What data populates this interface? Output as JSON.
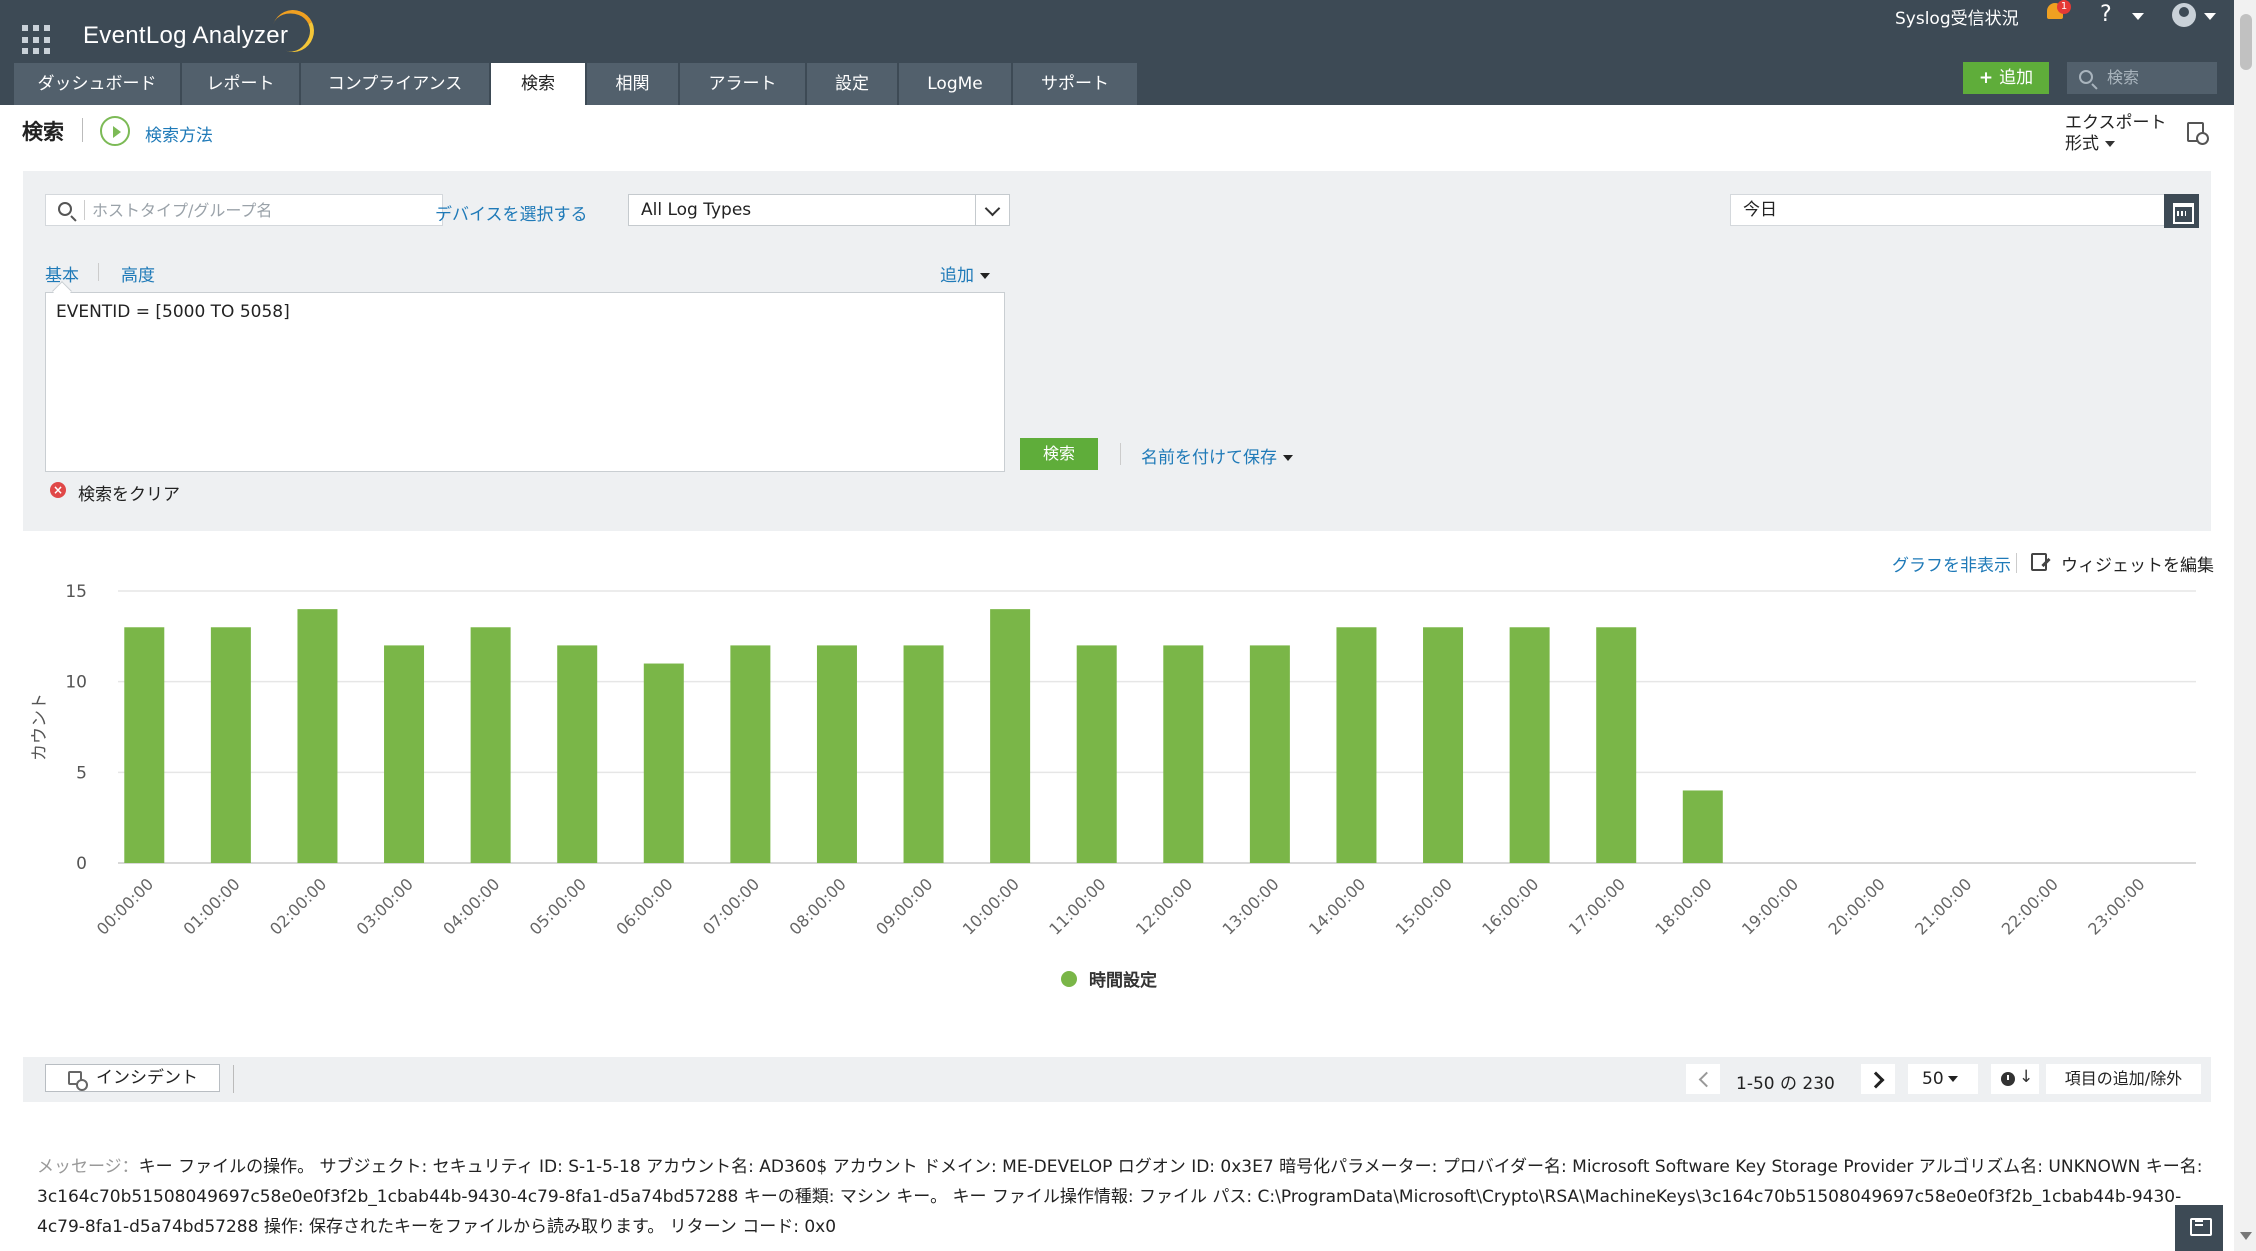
{
  "app": {
    "name": "EventLog Analyzer"
  },
  "header": {
    "syslog_status": "Syslog受信状況",
    "notifications_count": "1",
    "help_label": "?",
    "add_label": "追加",
    "search_placeholder": "検索",
    "icons": {
      "apps": "grid-icon",
      "bell": "bell-icon",
      "user": "user-icon",
      "search": "search-icon"
    }
  },
  "nav": {
    "tabs": [
      {
        "label": "ダッシュボード",
        "active": false
      },
      {
        "label": "レポート",
        "active": false
      },
      {
        "label": "コンプライアンス",
        "active": false
      },
      {
        "label": "検索",
        "active": true
      },
      {
        "label": "相関",
        "active": false
      },
      {
        "label": "アラート",
        "active": false
      },
      {
        "label": "設定",
        "active": false
      },
      {
        "label": "LogMe",
        "active": false
      },
      {
        "label": "サポート",
        "active": false
      }
    ]
  },
  "page": {
    "title": "検索",
    "how_to_search": "検索方法",
    "export_line1": "エクスポート",
    "export_line2": "形式"
  },
  "search": {
    "host_placeholder": "ホストタイプ/グループ名",
    "select_devices": "デバイスを選択する",
    "log_type": "All Log Types",
    "date_range": "今日",
    "tab_basic": "基本",
    "tab_advanced": "高度",
    "add_label": "追加",
    "query": "EVENTID = [5000 TO 5058]",
    "search_button": "検索",
    "save_as": "名前を付けて保存",
    "clear_search": "検索をクリア"
  },
  "chart_controls": {
    "hide_graph": "グラフを非表示",
    "edit_widget": "ウィジェットを編集"
  },
  "chart_data": {
    "type": "bar",
    "categories": [
      "00:00:00",
      "01:00:00",
      "02:00:00",
      "03:00:00",
      "04:00:00",
      "05:00:00",
      "06:00:00",
      "07:00:00",
      "08:00:00",
      "09:00:00",
      "10:00:00",
      "11:00:00",
      "12:00:00",
      "13:00:00",
      "14:00:00",
      "15:00:00",
      "16:00:00",
      "17:00:00",
      "18:00:00",
      "19:00:00",
      "20:00:00",
      "21:00:00",
      "22:00:00",
      "23:00:00"
    ],
    "series": [
      {
        "name": "時間設定",
        "values": [
          13,
          13,
          14,
          12,
          13,
          12,
          11,
          12,
          12,
          12,
          14,
          12,
          12,
          12,
          13,
          13,
          13,
          13,
          4,
          0,
          0,
          0,
          0,
          0
        ]
      }
    ],
    "ylabel": "カウント",
    "xlabel": "",
    "ylim": [
      0,
      15
    ],
    "yticks": [
      0,
      5,
      10,
      15
    ],
    "grid": true,
    "legend": "bottom-center",
    "bar_color": "#7ab648"
  },
  "results": {
    "incident_button": "インシデント",
    "page_range": "1-50 の 230",
    "page_size": "50",
    "sort_icon": "clock-sort-icon",
    "add_remove_columns": "項目の追加/除外"
  },
  "message": {
    "label": "メッセージ：",
    "text": "キー ファイルの操作。 サブジェクト: セキュリティ ID: S-1-5-18 アカウント名: AD360$ アカウント ドメイン: ME-DEVELOP ログオン ID: 0x3E7 暗号化パラメーター: プロバイダー名: Microsoft Software Key Storage Provider アルゴリズム名: UNKNOWN キー名: 3c164c70b51508049697c58e0e0f3f2b_1cbab44b-9430-4c79-8fa1-d5a74bd57288 キーの種類: マシン キー。 キー ファイル操作情報: ファイル パス: C:\\ProgramData\\Microsoft\\Crypto\\RSA\\MachineKeys\\3c164c70b51508049697c58e0e0f3f2b_1cbab44b-9430-4c79-8fa1-d5a74bd57288 操作: 保存されたキーをファイルから読み取ります。 リターン コード: 0x0"
  }
}
